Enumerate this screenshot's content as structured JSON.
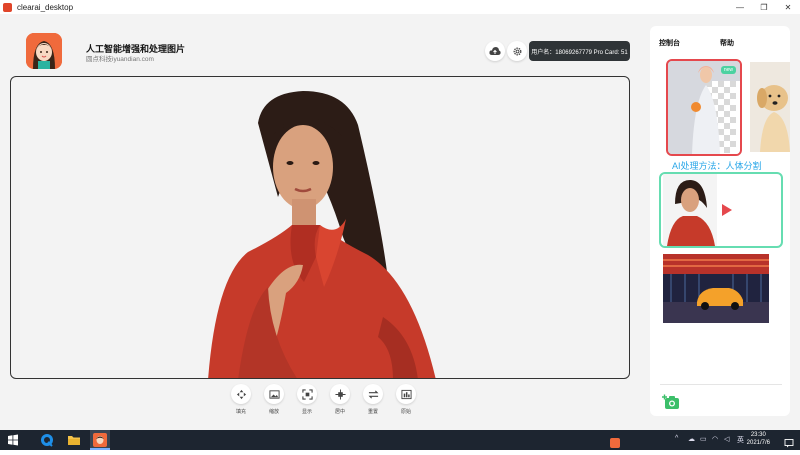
{
  "window": {
    "title": "clearai_desktop"
  },
  "header": {
    "app_name": "人工智能增强和处理图片",
    "app_sub": "圆点科技iyuandian.com",
    "user_badge": "用户名：18069267779 Pro Card: 51"
  },
  "toolbar": {
    "tools": [
      {
        "label": "填充",
        "icon": "move-icon"
      },
      {
        "label": "缩放",
        "icon": "image-icon"
      },
      {
        "label": "显示",
        "icon": "crop-icon"
      },
      {
        "label": "居中",
        "icon": "center-icon"
      },
      {
        "label": "重置",
        "icon": "swap-icon"
      },
      {
        "label": "原始",
        "icon": "compare-icon"
      }
    ]
  },
  "sidebar": {
    "tabs": [
      "控制台",
      "帮助"
    ],
    "badge_new": "new",
    "ai_method_label": "AI处理方法：人体分割"
  },
  "taskbar": {
    "time": "23:30",
    "date": "2021/7/6",
    "ime": "英"
  },
  "colors": {
    "accent_red": "#e5484d",
    "accent_green": "#66ddb1",
    "accent_blue": "#2aa7e8",
    "badge_bg": "#2f3437"
  }
}
